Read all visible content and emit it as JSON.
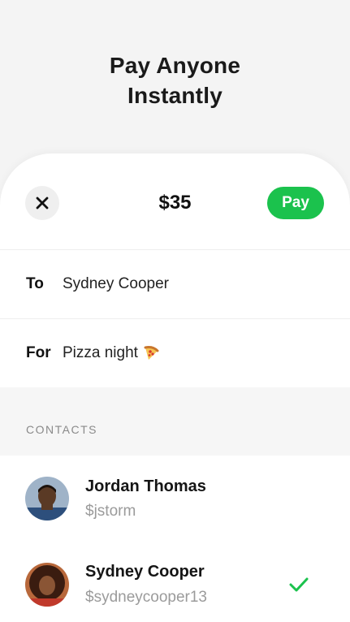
{
  "hero": {
    "title_line1": "Pay Anyone",
    "title_line2": "Instantly"
  },
  "payment": {
    "amount": "$35",
    "pay_label": "Pay",
    "close_icon": "close-icon",
    "accent_color": "#1bc24d"
  },
  "fields": {
    "to_label": "To",
    "to_value": "Sydney Cooper",
    "for_label": "For",
    "for_value": "Pizza night",
    "for_icon": "pizza-icon"
  },
  "contacts": {
    "section_label": "CONTACTS",
    "items": [
      {
        "name": "Jordan Thomas",
        "handle": "$jstorm",
        "selected": false
      },
      {
        "name": "Sydney Cooper",
        "handle": "$sydneycooper13",
        "selected": true
      }
    ]
  }
}
